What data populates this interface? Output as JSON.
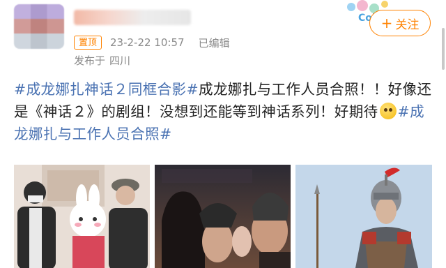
{
  "post": {
    "pinned_label": "置顶",
    "timestamp": "23-2-22 10:57",
    "edited_label": "已编辑",
    "location_prefix": "发布于",
    "location": "四川",
    "follow_label": "关注",
    "follow_icon": "plus-icon",
    "text_parts": {
      "tag1": "#成龙娜扎神话２同框合影#",
      "body1": "成龙娜扎与工作人员合照！！好像还是《神话２》的剧组！没想到还能等到神话系列！好期待",
      "emoji": "smiling-face-emoji",
      "tag2": "#成龙娜扎与工作人员合照#"
    }
  },
  "sticker": {
    "text": "Coi"
  },
  "images": [
    {
      "name": "photo-group-with-rabbit-mascot"
    },
    {
      "name": "photo-movie-poster"
    },
    {
      "name": "photo-general-in-armor"
    }
  ],
  "colors": {
    "accent": "#ff8200",
    "hashtag": "#4a72b2",
    "meta": "#8a8a8a"
  }
}
